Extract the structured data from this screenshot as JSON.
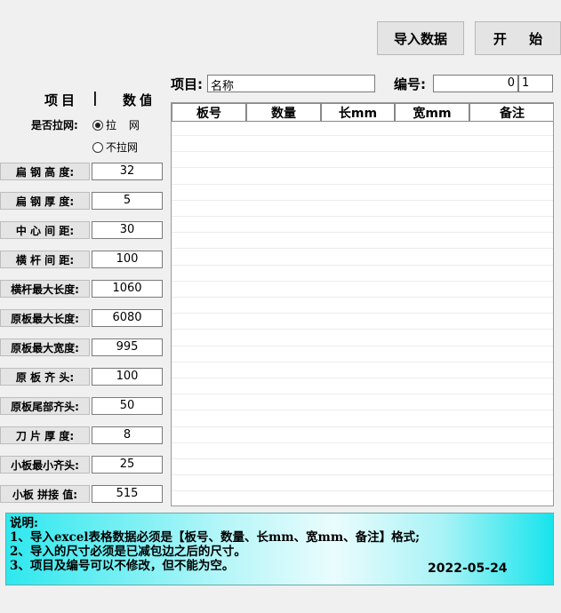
{
  "toolbar": {
    "import_label": "导入数据",
    "start_label": "开 始"
  },
  "left_header": {
    "item": "项目",
    "separator": "|",
    "value": "数值"
  },
  "net": {
    "label": "是否拉网:",
    "options": [
      {
        "label": "拉 网",
        "selected": true
      },
      {
        "label": "不拉网",
        "selected": false
      }
    ]
  },
  "params": [
    {
      "label": "扁 钢 高 度:",
      "value": "32"
    },
    {
      "label": "扁 钢 厚 度:",
      "value": "5"
    },
    {
      "label": "中 心 间 距:",
      "value": "30"
    },
    {
      "label": "横 杆 间 距:",
      "value": "100"
    },
    {
      "label": "横杆最大长度:",
      "value": "1060"
    },
    {
      "label": "原板最大长度:",
      "value": "6080"
    },
    {
      "label": "原板最大宽度:",
      "value": "995"
    },
    {
      "label": "原 板 齐 头:",
      "value": "100"
    },
    {
      "label": "原板尾部齐头:",
      "value": "50"
    },
    {
      "label": "刀 片 厚 度:",
      "value": "8"
    },
    {
      "label": "小板最小齐头:",
      "value": "25"
    },
    {
      "label": "小板 拼接 值:",
      "value": "515"
    }
  ],
  "project": {
    "item_label": "项目:",
    "item_value": "名称",
    "no_label": "编号:",
    "no_value1": "0",
    "no_value2": "1"
  },
  "table": {
    "columns": [
      "板号",
      "数量",
      "长mm",
      "宽mm",
      "备注"
    ],
    "rows": []
  },
  "notes": {
    "lines": [
      "说明:",
      "1、导入excel表格数据必须是【板号、数量、长mm、宽mm、备注】格式;",
      "2、导入的尺寸必须是已减包边之后的尺寸。",
      "3、项目及编号可以不修改，但不能为空。"
    ],
    "date": "2022-05-24"
  },
  "colors": {
    "background": "#f0f0f0",
    "notes_gradient_edge": "#17e4ec",
    "notes_gradient_center": "#eafcfd"
  }
}
